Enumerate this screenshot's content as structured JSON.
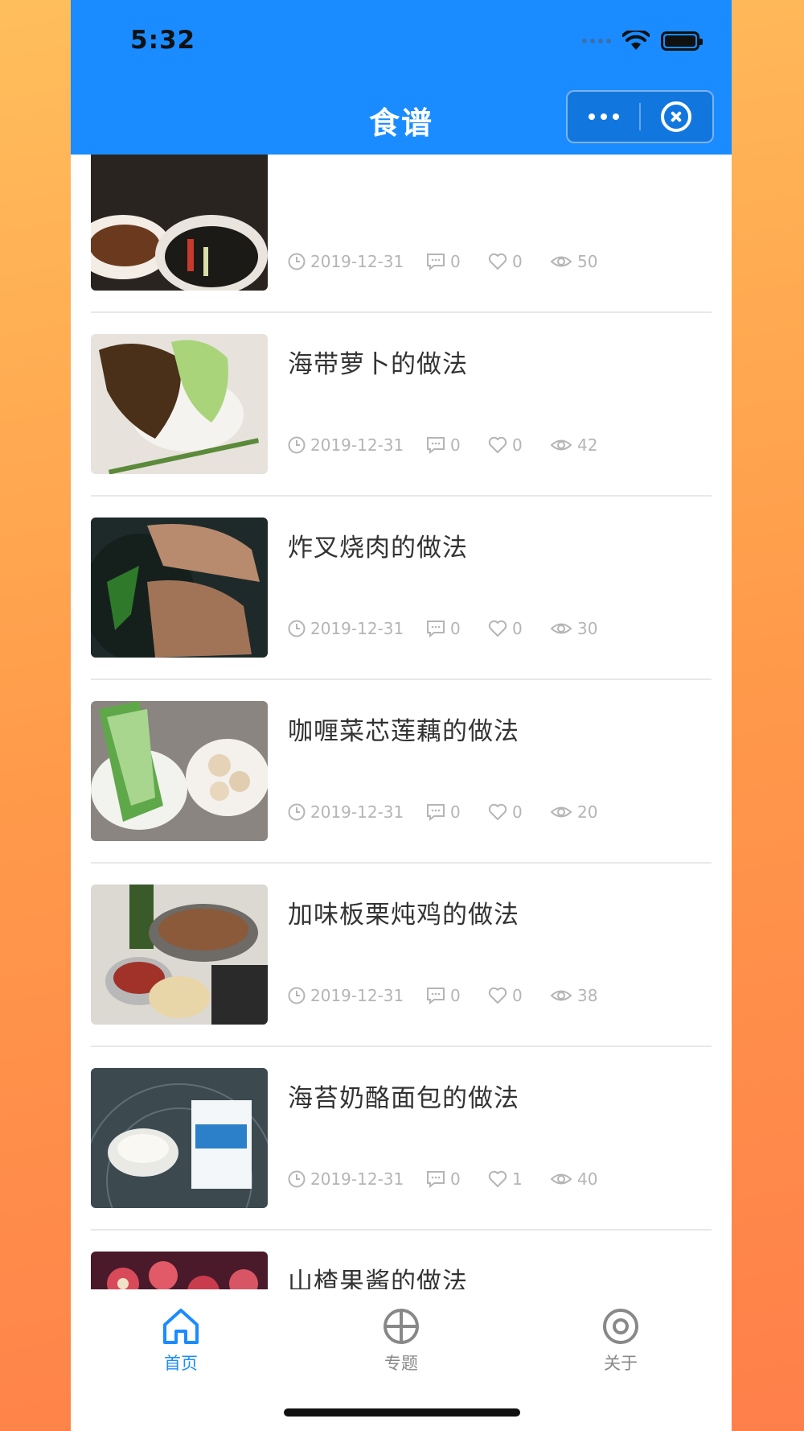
{
  "status_bar": {
    "time": "5:32"
  },
  "nav": {
    "title": "食谱"
  },
  "recipes": [
    {
      "title": "",
      "date": "2019-12-31",
      "comments": "0",
      "likes": "0",
      "views": "50"
    },
    {
      "title": "海带萝卜的做法",
      "date": "2019-12-31",
      "comments": "0",
      "likes": "0",
      "views": "42"
    },
    {
      "title": "炸叉烧肉的做法",
      "date": "2019-12-31",
      "comments": "0",
      "likes": "0",
      "views": "30"
    },
    {
      "title": "咖喱菜芯莲藕的做法",
      "date": "2019-12-31",
      "comments": "0",
      "likes": "0",
      "views": "20"
    },
    {
      "title": "加味板栗炖鸡的做法",
      "date": "2019-12-31",
      "comments": "0",
      "likes": "0",
      "views": "38"
    },
    {
      "title": "海苔奶酪面包的做法",
      "date": "2019-12-31",
      "comments": "0",
      "likes": "1",
      "views": "40"
    },
    {
      "title": "山楂果酱的做法",
      "date": "",
      "comments": "",
      "likes": "",
      "views": ""
    }
  ],
  "tabbar": {
    "items": [
      {
        "label": "首页",
        "icon": "home-icon",
        "active": true
      },
      {
        "label": "专题",
        "icon": "topic-icon",
        "active": false
      },
      {
        "label": "关于",
        "icon": "about-icon",
        "active": false
      }
    ]
  },
  "colors": {
    "primary": "#1a8cff",
    "meta_text": "#b5b5b5",
    "title_text": "#333333"
  }
}
